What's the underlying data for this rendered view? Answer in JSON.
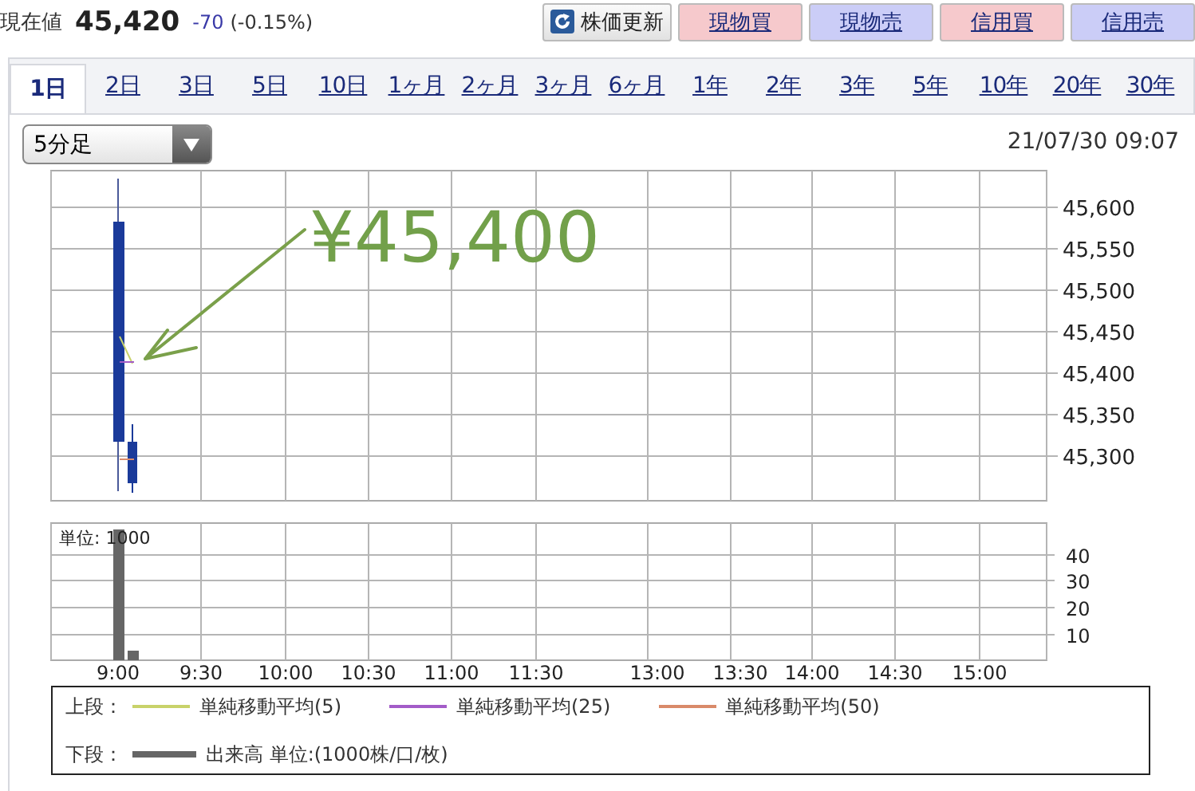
{
  "header": {
    "label": "現在値",
    "price": "45,420",
    "change": "-70",
    "change_pct": "(-0.15%)"
  },
  "buttons": [
    {
      "label": "株価更新",
      "kind": "refresh"
    },
    {
      "label": "現物買",
      "kind": "buy"
    },
    {
      "label": "現物売",
      "kind": "sell"
    },
    {
      "label": "信用買",
      "kind": "buy"
    },
    {
      "label": "信用売",
      "kind": "sell"
    }
  ],
  "tabs": [
    {
      "label": "1日",
      "selected": true
    },
    {
      "label": "2日",
      "selected": false
    },
    {
      "label": "3日",
      "selected": false
    },
    {
      "label": "5日",
      "selected": false
    },
    {
      "label": "10日",
      "selected": false
    },
    {
      "label": "1ヶ月",
      "selected": false
    },
    {
      "label": "2ヶ月",
      "selected": false
    },
    {
      "label": "3ヶ月",
      "selected": false
    },
    {
      "label": "6ヶ月",
      "selected": false
    },
    {
      "label": "1年",
      "selected": false
    },
    {
      "label": "2年",
      "selected": false
    },
    {
      "label": "3年",
      "selected": false
    },
    {
      "label": "5年",
      "selected": false
    },
    {
      "label": "10年",
      "selected": false
    },
    {
      "label": "20年",
      "selected": false
    },
    {
      "label": "30年",
      "selected": false
    }
  ],
  "interval_select": {
    "value": "5分足"
  },
  "timestamp": "21/07/30 09:07",
  "price_chart": {
    "y_ticks": [
      "45,600",
      "45,550",
      "45,500",
      "45,450",
      "45,400",
      "45,350",
      "45,300"
    ],
    "annotation": "¥45,400"
  },
  "volume_chart": {
    "unit_label": "単位: 1000",
    "y_ticks": [
      "40",
      "30",
      "20",
      "10"
    ]
  },
  "time_labels": [
    "9:00",
    "9:30",
    "10:00",
    "10:30",
    "11:00",
    "11:30",
    "13:00",
    "13:30",
    "14:00",
    "14:30",
    "15:00"
  ],
  "legend": {
    "upper_label": "上段：",
    "upper": [
      {
        "name": "単純移動平均(5)",
        "color": "#c8d26a"
      },
      {
        "name": "単純移動平均(25)",
        "color": "#a35cc8"
      },
      {
        "name": "単純移動平均(50)",
        "color": "#d98a6a"
      }
    ],
    "lower_label": "下段：",
    "lower": [
      {
        "name": "出来高 単位:(1000株/口/枚)",
        "color": "#666666"
      }
    ]
  }
}
